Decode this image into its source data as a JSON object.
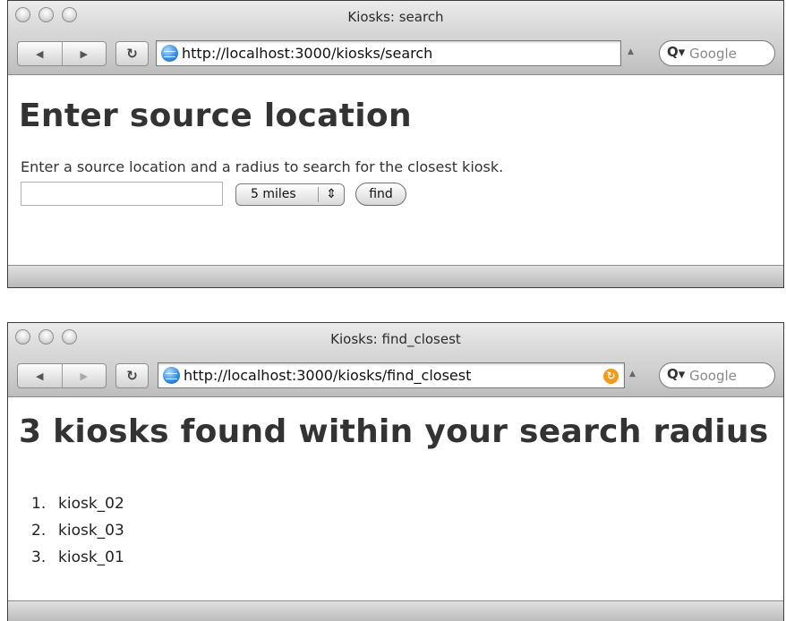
{
  "window1": {
    "title": "Kiosks: search",
    "url": "http://localhost:3000/kiosks/search",
    "search_placeholder": "Google",
    "heading": "Enter source location",
    "prompt": "Enter a source location and a radius to search for the closest kiosk.",
    "location_value": "",
    "radius_selected": "5 miles",
    "find_label": "find"
  },
  "window2": {
    "title": "Kiosks: find_closest",
    "url": "http://localhost:3000/kiosks/find_closest",
    "search_placeholder": "Google",
    "heading": "3 kiosks found within your search radius",
    "results": [
      {
        "num": "1.",
        "name": "kiosk_02"
      },
      {
        "num": "2.",
        "name": "kiosk_03"
      },
      {
        "num": "3.",
        "name": "kiosk_01"
      }
    ]
  }
}
